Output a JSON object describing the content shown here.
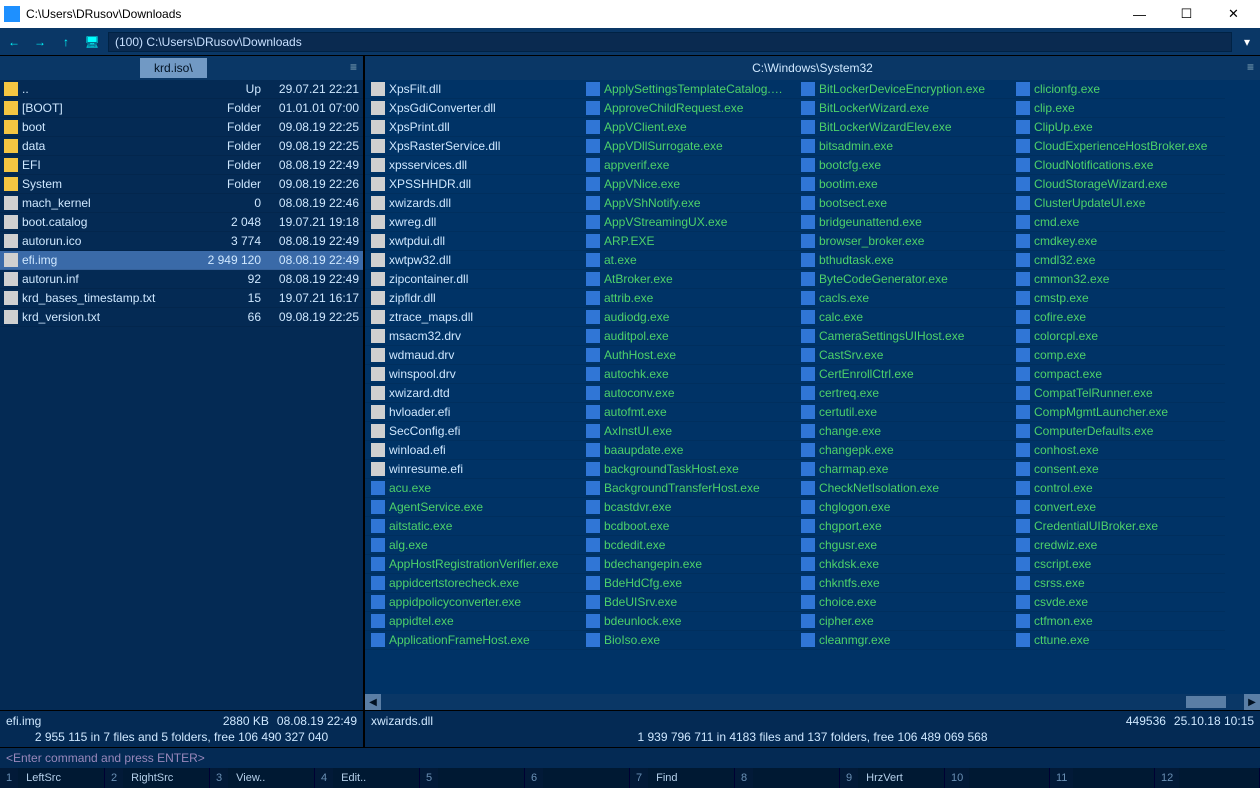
{
  "title": "C:\\Users\\DRusov\\Downloads",
  "address": "(100) C:\\Users\\DRusov\\Downloads",
  "left": {
    "tab": "krd.iso\\",
    "rows": [
      {
        "icon": "folder",
        "name": "..",
        "size": "Up",
        "date": "29.07.21 22:21"
      },
      {
        "icon": "folder",
        "name": "[BOOT]",
        "size": "Folder",
        "date": "01.01.01 07:00"
      },
      {
        "icon": "folder",
        "name": "boot",
        "size": "Folder",
        "date": "09.08.19 22:25"
      },
      {
        "icon": "folder",
        "name": "data",
        "size": "Folder",
        "date": "09.08.19 22:25"
      },
      {
        "icon": "folder",
        "name": "EFI",
        "size": "Folder",
        "date": "08.08.19 22:49"
      },
      {
        "icon": "folder",
        "name": "System",
        "size": "Folder",
        "date": "09.08.19 22:26"
      },
      {
        "icon": "file",
        "name": "mach_kernel",
        "size": "0",
        "date": "08.08.19 22:46"
      },
      {
        "icon": "file",
        "name": "boot.catalog",
        "size": "2 048",
        "date": "19.07.21 19:18"
      },
      {
        "icon": "file",
        "name": "autorun.ico",
        "size": "3 774",
        "date": "08.08.19 22:49"
      },
      {
        "icon": "file",
        "name": "efi.img",
        "size": "2 949 120",
        "date": "08.08.19 22:49",
        "selected": true
      },
      {
        "icon": "file",
        "name": "autorun.inf",
        "size": "92",
        "date": "08.08.19 22:49"
      },
      {
        "icon": "file",
        "name": "krd_bases_timestamp.txt",
        "size": "15",
        "date": "19.07.21 16:17"
      },
      {
        "icon": "file",
        "name": "krd_version.txt",
        "size": "66",
        "date": "09.08.19 22:25"
      }
    ],
    "status_name": "efi.img",
    "status_size": "2880 KB",
    "status_date": "08.08.19 22:49",
    "summary": "2 955 115 in 7 files and 5 folders, free 106 490 327 040"
  },
  "right": {
    "title": "C:\\Windows\\System32",
    "cols": [
      [
        "XpsFilt.dll",
        "XpsGdiConverter.dll",
        "XpsPrint.dll",
        "XpsRasterService.dll",
        "xpsservices.dll",
        "XPSSHHDR.dll",
        "xwizards.dll",
        "xwreg.dll",
        "xwtpdui.dll",
        "xwtpw32.dll",
        "zipcontainer.dll",
        "zipfldr.dll",
        "ztrace_maps.dll",
        "msacm32.drv",
        "wdmaud.drv",
        "winspool.drv",
        "xwizard.dtd",
        "hvloader.efi",
        "SecConfig.efi",
        "winload.efi",
        "winresume.efi",
        "acu.exe",
        "AgentService.exe",
        "aitstatic.exe",
        "alg.exe",
        "AppHostRegistrationVerifier.exe",
        "appidcertstorecheck.exe",
        "appidpolicyconverter.exe",
        "appidtel.exe",
        "ApplicationFrameHost.exe"
      ],
      [
        "ApplySettingsTemplateCatalog.exe",
        "ApproveChildRequest.exe",
        "AppVClient.exe",
        "AppVDllSurrogate.exe",
        "appverif.exe",
        "AppVNice.exe",
        "AppVShNotify.exe",
        "AppVStreamingUX.exe",
        "ARP.EXE",
        "at.exe",
        "AtBroker.exe",
        "attrib.exe",
        "audiodg.exe",
        "auditpol.exe",
        "AuthHost.exe",
        "autochk.exe",
        "autoconv.exe",
        "autofmt.exe",
        "AxInstUI.exe",
        "baaupdate.exe",
        "backgroundTaskHost.exe",
        "BackgroundTransferHost.exe",
        "bcastdvr.exe",
        "bcdboot.exe",
        "bcdedit.exe",
        "bdechangepin.exe",
        "BdeHdCfg.exe",
        "BdeUISrv.exe",
        "bdeunlock.exe",
        "BioIso.exe"
      ],
      [
        "BitLockerDeviceEncryption.exe",
        "BitLockerWizard.exe",
        "BitLockerWizardElev.exe",
        "bitsadmin.exe",
        "bootcfg.exe",
        "bootim.exe",
        "bootsect.exe",
        "bridgeunattend.exe",
        "browser_broker.exe",
        "bthudtask.exe",
        "ByteCodeGenerator.exe",
        "cacls.exe",
        "calc.exe",
        "CameraSettingsUIHost.exe",
        "CastSrv.exe",
        "CertEnrollCtrl.exe",
        "certreq.exe",
        "certutil.exe",
        "change.exe",
        "changepk.exe",
        "charmap.exe",
        "CheckNetIsolation.exe",
        "chglogon.exe",
        "chgport.exe",
        "chgusr.exe",
        "chkdsk.exe",
        "chkntfs.exe",
        "choice.exe",
        "cipher.exe",
        "cleanmgr.exe"
      ],
      [
        "clicionfg.exe",
        "clip.exe",
        "ClipUp.exe",
        "CloudExperienceHostBroker.exe",
        "CloudNotifications.exe",
        "CloudStorageWizard.exe",
        "ClusterUpdateUI.exe",
        "cmd.exe",
        "cmdkey.exe",
        "cmdl32.exe",
        "cmmon32.exe",
        "cmstp.exe",
        "cofire.exe",
        "colorcpl.exe",
        "comp.exe",
        "compact.exe",
        "CompatTelRunner.exe",
        "CompMgmtLauncher.exe",
        "ComputerDefaults.exe",
        "conhost.exe",
        "consent.exe",
        "control.exe",
        "convert.exe",
        "CredentialUIBroker.exe",
        "credwiz.exe",
        "cscript.exe",
        "csrss.exe",
        "csvde.exe",
        "ctfmon.exe",
        "cttune.exe"
      ]
    ],
    "green_col0_from": 21,
    "status_name": "xwizards.dll",
    "status_size": "449536",
    "status_date": "25.10.18 10:15",
    "summary": "1 939 796 711 in 4183 files and 137 folders, free 106 489 069 568"
  },
  "cmdline": "<Enter command and press ENTER>",
  "fkeys": [
    {
      "n": "1",
      "l": "LeftSrc"
    },
    {
      "n": "2",
      "l": "RightSrc"
    },
    {
      "n": "3",
      "l": "View.."
    },
    {
      "n": "4",
      "l": "Edit.."
    },
    {
      "n": "5",
      "l": ""
    },
    {
      "n": "6",
      "l": ""
    },
    {
      "n": "7",
      "l": "Find"
    },
    {
      "n": "8",
      "l": ""
    },
    {
      "n": "9",
      "l": "HrzVert"
    },
    {
      "n": "10",
      "l": ""
    },
    {
      "n": "11",
      "l": ""
    },
    {
      "n": "12",
      "l": ""
    }
  ]
}
